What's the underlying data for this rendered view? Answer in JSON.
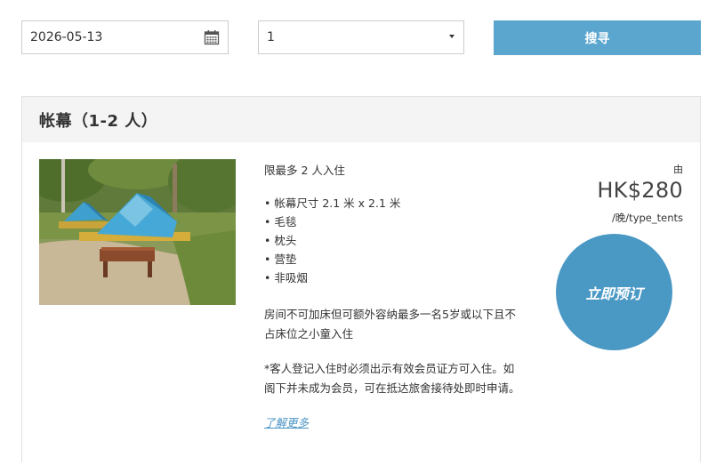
{
  "search_bar": {
    "date_value": "2026-05-13",
    "guests_value": "1",
    "search_label": "搜寻"
  },
  "room": {
    "title": "帐幕（1-2 人）",
    "occupancy": "限最多 2 人入住",
    "amenities": [
      "帐幕尺寸 2.1 米 x 2.1 米",
      "毛毯",
      "枕头",
      "营垫",
      "非吸烟"
    ],
    "bed_note": "房间不可加床但可额外容纳最多一名5岁或以下且不占床位之小童入住",
    "member_note": "*客人登记入住时必须出示有效会员证方可入住。如阁下并未成为会员，可在抵达旅舍接待处即时申请。",
    "learn_more_label": "了解更多",
    "price_from": "由",
    "price": "HK$280",
    "price_unit": "/晚/type_tents",
    "book_label": "立即预订"
  },
  "colors": {
    "accent": "#5aa6ce",
    "book_button": "#4a98c4",
    "link": "#4a94c4",
    "header_bg": "#f4f4f4"
  },
  "icons": [
    "calendar-icon",
    "chevron-down-icon"
  ]
}
